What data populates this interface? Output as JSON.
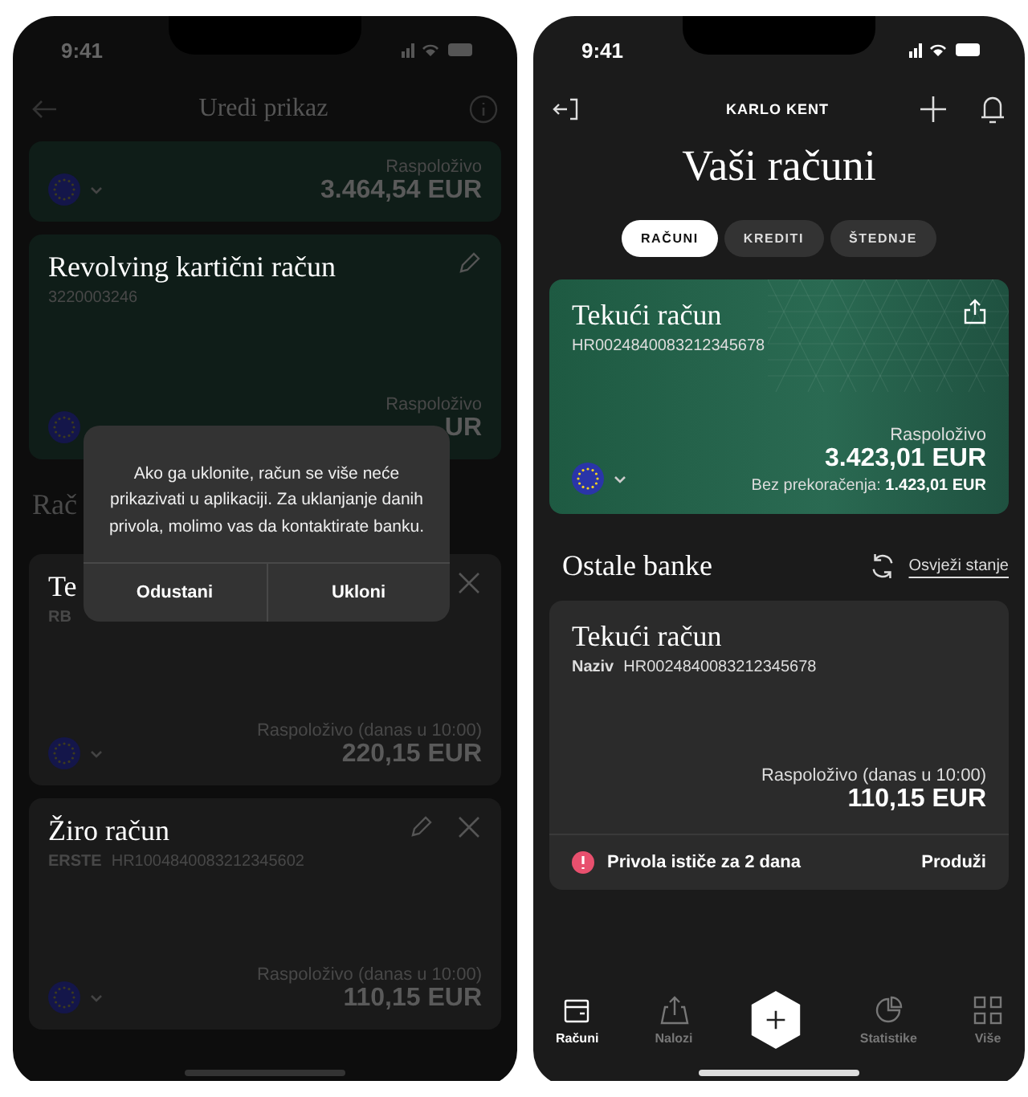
{
  "edit_screen": {
    "status_time": "9:41",
    "title": "Uredi prikaz",
    "top_card": {
      "label": "Raspoloživo",
      "amount": "3.464,54 EUR"
    },
    "revolving_card": {
      "name": "Revolving kartični račun",
      "number": "3220003246",
      "label": "Raspoloživo",
      "amount": "UR",
      "editable": true,
      "removable": false
    },
    "section_title": "Rač",
    "accounts": [
      {
        "name": "Te",
        "bank": "RB",
        "label": "Raspoloživo (danas u 10:00)",
        "amount": "220,15 EUR",
        "editable": false,
        "removable": true
      },
      {
        "name": "Žiro račun",
        "bank": "ERSTE",
        "iban": "HR1004840083212345602",
        "label": "Raspoloživo (danas u 10:00)",
        "amount": "110,15 EUR",
        "editable": true,
        "removable": true
      }
    ],
    "dialog": {
      "message": "Ako ga uklonite, račun se više neće prikazivati u aplikaciji. Za uklanjanje danih privola, molimo vas da kontaktirate banku.",
      "buttons": [
        "Odustani",
        "Ukloni"
      ]
    }
  },
  "accounts_screen": {
    "status_time": "9:41",
    "user": "KARLO KENT",
    "title": "Vaši računi",
    "tabs": [
      {
        "label": "RAČUNI",
        "selected": true
      },
      {
        "label": "KREDITI",
        "selected": false
      },
      {
        "label": "ŠTEDNJE",
        "selected": false
      }
    ],
    "main_account": {
      "name": "Tekući račun",
      "iban": "HR0024840083212345678",
      "label": "Raspoloživo",
      "amount": "3.423,01 EUR",
      "overdraft": "Bez prekoračenja: **1.423,01 EUR**"
    },
    "other_banks": {
      "title": "Ostale banke",
      "refresh": "Osvježi stanje",
      "account": {
        "name": "Tekući račun",
        "bank": "Naziv",
        "iban": "HR0024840083212345678",
        "label": "Raspoloživo (danas u 10:00)",
        "amount": "110,15 EUR",
        "notice": "Privola ističe za 2 dana",
        "action": "Produži"
      }
    },
    "nav": [
      {
        "kind": "wallet",
        "label": "Računi",
        "selected": true
      },
      {
        "kind": "upload",
        "label": "Nalozi",
        "selected": false
      },
      {
        "kind": "add",
        "selected": false
      },
      {
        "kind": "chart",
        "label": "Statistike",
        "selected": false
      },
      {
        "kind": "grid",
        "label": "Više",
        "selected": false
      }
    ]
  }
}
